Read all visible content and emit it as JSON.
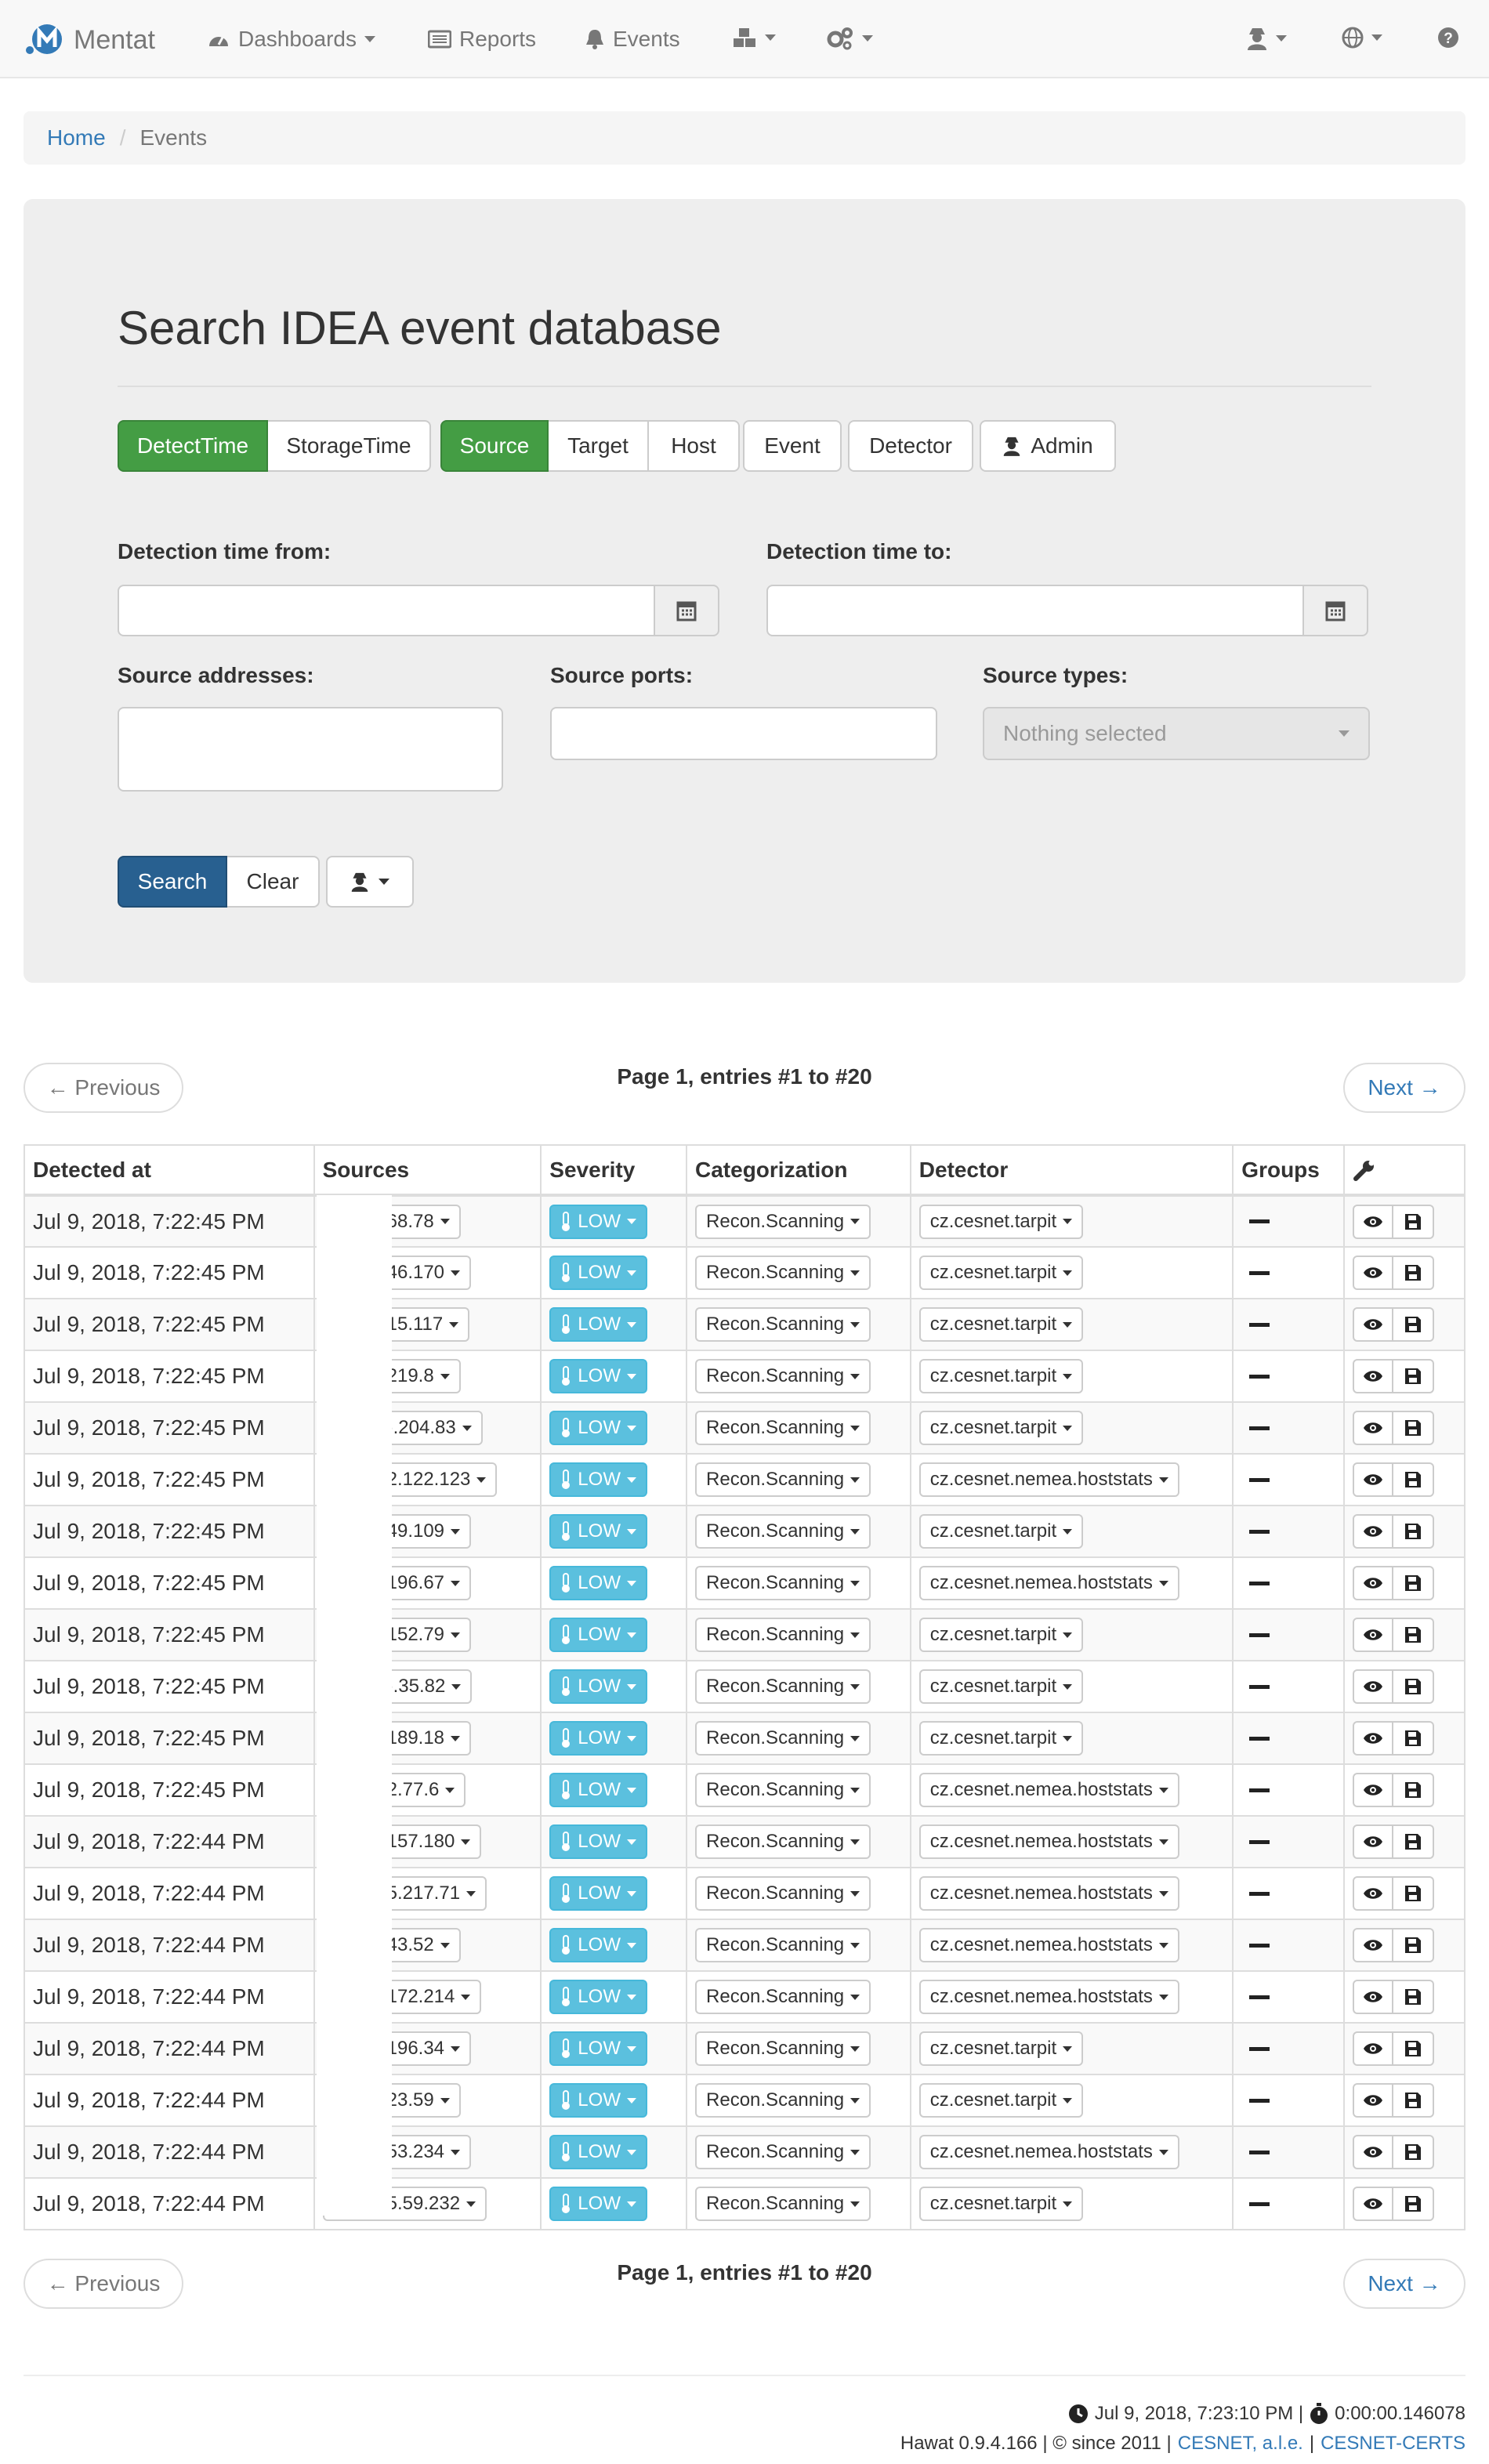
{
  "navbar": {
    "brand": "Mentat",
    "items": [
      {
        "label": "Dashboards",
        "icon": "dashboard-icon",
        "dropdown": true
      },
      {
        "label": "Reports",
        "icon": "list-icon",
        "dropdown": false
      },
      {
        "label": "Events",
        "icon": "bell-icon",
        "dropdown": false
      },
      {
        "label": "",
        "icon": "cubes-icon",
        "dropdown": true
      },
      {
        "label": "",
        "icon": "cogs-icon",
        "dropdown": true
      },
      {
        "label": "",
        "icon": "user-secret-icon",
        "dropdown": true
      },
      {
        "label": "",
        "icon": "globe-icon",
        "dropdown": true
      },
      {
        "label": "",
        "icon": "question-icon",
        "dropdown": false
      }
    ]
  },
  "breadcrumb": {
    "home": "Home",
    "current": "Events"
  },
  "search": {
    "title": "Search IDEA event database",
    "time_buttons": [
      "DetectTime",
      "StorageTime"
    ],
    "section_buttons": [
      "Source",
      "Target",
      "Host"
    ],
    "event_button": "Event",
    "detector_button": "Detector",
    "admin_button": "Admin",
    "detection_from_label": "Detection time from:",
    "detection_to_label": "Detection time to:",
    "source_addresses_label": "Source addresses:",
    "source_ports_label": "Source ports:",
    "source_types_label": "Source types:",
    "source_types_placeholder": "Nothing selected",
    "search_button": "Search",
    "clear_button": "Clear"
  },
  "pager": {
    "previous": "← Previous",
    "next": "Next →",
    "info": "Page 1, entries #1 to #20"
  },
  "table": {
    "headers": [
      "Detected at",
      "Sources",
      "Severity",
      "Categorization",
      "Detector",
      "Groups"
    ],
    "rows": [
      {
        "detected": "Jul 9, 2018, 7:22:45 PM",
        "source": "68.78",
        "severity": "LOW",
        "category": "Recon.Scanning",
        "detector": "cz.cesnet.tarpit"
      },
      {
        "detected": "Jul 9, 2018, 7:22:45 PM",
        "source": "46.170",
        "severity": "LOW",
        "category": "Recon.Scanning",
        "detector": "cz.cesnet.tarpit"
      },
      {
        "detected": "Jul 9, 2018, 7:22:45 PM",
        "source": "15.117",
        "severity": "LOW",
        "category": "Recon.Scanning",
        "detector": "cz.cesnet.tarpit"
      },
      {
        "detected": "Jul 9, 2018, 7:22:45 PM",
        "source": "219.8",
        "severity": "LOW",
        "category": "Recon.Scanning",
        "detector": "cz.cesnet.tarpit"
      },
      {
        "detected": "Jul 9, 2018, 7:22:45 PM",
        "source": ").204.83",
        "severity": "LOW",
        "category": "Recon.Scanning",
        "detector": "cz.cesnet.tarpit"
      },
      {
        "detected": "Jul 9, 2018, 7:22:45 PM",
        "source": "2.122.123",
        "severity": "LOW",
        "category": "Recon.Scanning",
        "detector": "cz.cesnet.nemea.hoststats"
      },
      {
        "detected": "Jul 9, 2018, 7:22:45 PM",
        "source": "49.109",
        "severity": "LOW",
        "category": "Recon.Scanning",
        "detector": "cz.cesnet.tarpit"
      },
      {
        "detected": "Jul 9, 2018, 7:22:45 PM",
        "source": "196.67",
        "severity": "LOW",
        "category": "Recon.Scanning",
        "detector": "cz.cesnet.nemea.hoststats"
      },
      {
        "detected": "Jul 9, 2018, 7:22:45 PM",
        "source": "152.79",
        "severity": "LOW",
        "category": "Recon.Scanning",
        "detector": "cz.cesnet.tarpit"
      },
      {
        "detected": "Jul 9, 2018, 7:22:45 PM",
        "source": ").35.82",
        "severity": "LOW",
        "category": "Recon.Scanning",
        "detector": "cz.cesnet.tarpit"
      },
      {
        "detected": "Jul 9, 2018, 7:22:45 PM",
        "source": "189.18",
        "severity": "LOW",
        "category": "Recon.Scanning",
        "detector": "cz.cesnet.tarpit"
      },
      {
        "detected": "Jul 9, 2018, 7:22:45 PM",
        "source": "2.77.6",
        "severity": "LOW",
        "category": "Recon.Scanning",
        "detector": "cz.cesnet.nemea.hoststats"
      },
      {
        "detected": "Jul 9, 2018, 7:22:44 PM",
        "source": "157.180",
        "severity": "LOW",
        "category": "Recon.Scanning",
        "detector": "cz.cesnet.nemea.hoststats"
      },
      {
        "detected": "Jul 9, 2018, 7:22:44 PM",
        "source": "5.217.71",
        "severity": "LOW",
        "category": "Recon.Scanning",
        "detector": "cz.cesnet.nemea.hoststats"
      },
      {
        "detected": "Jul 9, 2018, 7:22:44 PM",
        "source": "43.52",
        "severity": "LOW",
        "category": "Recon.Scanning",
        "detector": "cz.cesnet.nemea.hoststats"
      },
      {
        "detected": "Jul 9, 2018, 7:22:44 PM",
        "source": "172.214",
        "severity": "LOW",
        "category": "Recon.Scanning",
        "detector": "cz.cesnet.nemea.hoststats"
      },
      {
        "detected": "Jul 9, 2018, 7:22:44 PM",
        "source": "196.34",
        "severity": "LOW",
        "category": "Recon.Scanning",
        "detector": "cz.cesnet.tarpit"
      },
      {
        "detected": "Jul 9, 2018, 7:22:44 PM",
        "source": "23.59",
        "severity": "LOW",
        "category": "Recon.Scanning",
        "detector": "cz.cesnet.tarpit"
      },
      {
        "detected": "Jul 9, 2018, 7:22:44 PM",
        "source": "53.234",
        "severity": "LOW",
        "category": "Recon.Scanning",
        "detector": "cz.cesnet.nemea.hoststats"
      },
      {
        "detected": "Jul 9, 2018, 7:22:44 PM",
        "source": "5.59.232",
        "severity": "LOW",
        "category": "Recon.Scanning",
        "detector": "cz.cesnet.tarpit"
      }
    ]
  },
  "footer": {
    "timestamp": "Jul 9, 2018, 7:23:10 PM |",
    "duration": "0:00:00.146078",
    "version": "Hawat 0.9.4.166 | © since 2011 |",
    "link1": "CESNET, a.l.e.",
    "sep": "|",
    "link2": "CESNET-CERTS"
  },
  "colors": {
    "success": "#449d44",
    "primary": "#337ab7",
    "info": "#5bc0de"
  }
}
